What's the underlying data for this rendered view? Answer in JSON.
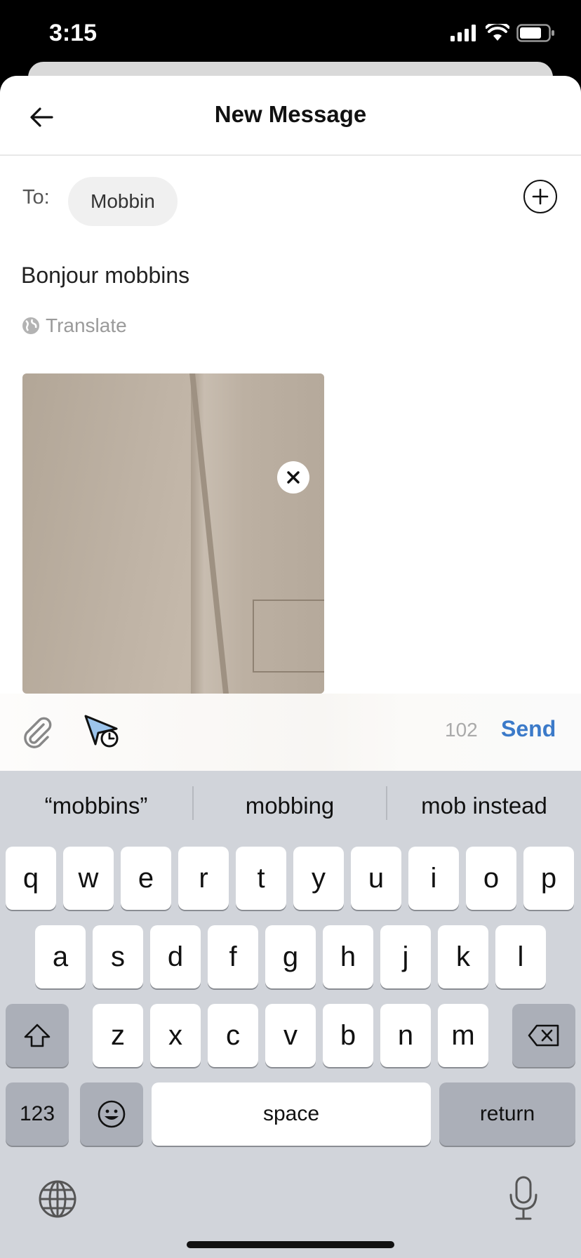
{
  "status_bar": {
    "time": "3:15",
    "icons": [
      "signal-icon",
      "wifi-icon",
      "battery-icon"
    ]
  },
  "header": {
    "title": "New Message",
    "back_icon": "arrow-left-icon"
  },
  "recipients": {
    "label": "To:",
    "chips": [
      "Mobbin"
    ],
    "add_icon": "plus-circle-icon"
  },
  "message": {
    "body": "Bonjour mobbins",
    "translate_label": "Translate",
    "translate_icon": "globe-icon",
    "attachment": {
      "type": "photo",
      "remove_icon": "close-icon"
    }
  },
  "compose_bar": {
    "attach_icon": "paperclip-icon",
    "schedule_icon": "scheduled-send-icon",
    "char_count": "102",
    "send_label": "Send",
    "send_color": "#3b7ac9"
  },
  "keyboard": {
    "suggestions": [
      "“mobbins”",
      "mobbing",
      "mob instead"
    ],
    "row1": [
      "q",
      "w",
      "e",
      "r",
      "t",
      "y",
      "u",
      "i",
      "o",
      "p"
    ],
    "row2": [
      "a",
      "s",
      "d",
      "f",
      "g",
      "h",
      "j",
      "k",
      "l"
    ],
    "row3": [
      "z",
      "x",
      "c",
      "v",
      "b",
      "n",
      "m"
    ],
    "numbers_label": "123",
    "space_label": "space",
    "return_label": "return",
    "icons": [
      "shift-icon",
      "backspace-icon",
      "emoji-icon",
      "globe-icon",
      "microphone-icon"
    ]
  }
}
